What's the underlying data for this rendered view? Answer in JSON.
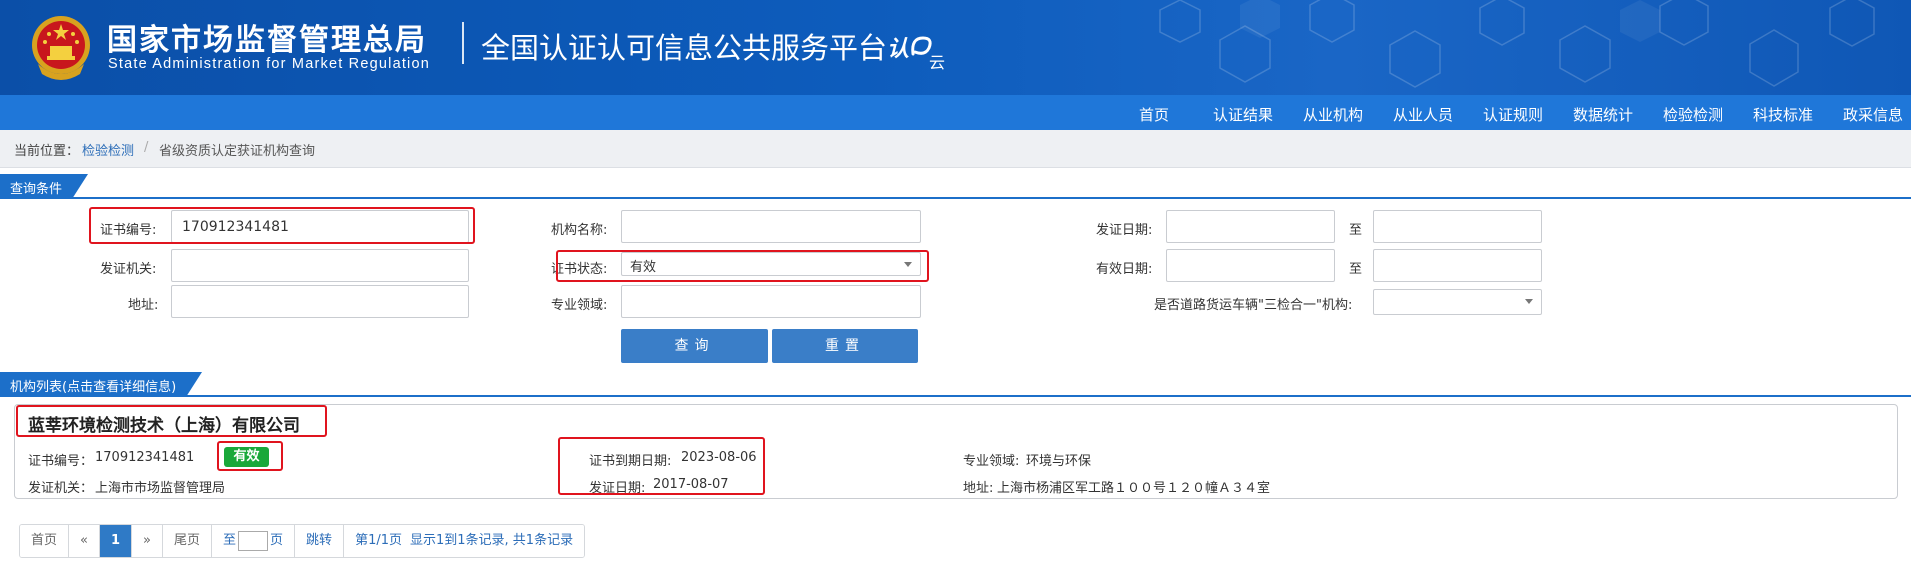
{
  "header": {
    "title_cn": "国家市场监督管理总局",
    "title_en": "State Administration  for  Market Regulation",
    "platform": "全国认证认可信息公共服务平台",
    "brand_logo_text": "认e云",
    "emblem_icon": "national-emblem-icon"
  },
  "nav": {
    "items": [
      "首页",
      "认证结果",
      "从业机构",
      "从业人员",
      "认证规则",
      "数据统计",
      "检验检测",
      "科技标准",
      "政采信息"
    ]
  },
  "breadcrumb": {
    "prefix": "当前位置：",
    "link": "检验检测",
    "separator": "/",
    "current": "省级资质认定获证机构查询"
  },
  "query": {
    "section_title": "查询条件",
    "cert_no_label": "证书编号:",
    "cert_no_value": "170912341481",
    "org_name_label": "机构名称:",
    "org_name_value": "",
    "issue_date_label": "发证日期:",
    "to_label": "至",
    "issuer_label": "发证机关:",
    "issuer_value": "",
    "cert_status_label": "证书状态:",
    "cert_status_value": "有效",
    "valid_date_label": "有效日期:",
    "address_label": "地址:",
    "address_value": "",
    "field_label": "专业领域:",
    "field_value": "",
    "three_in_one_label": "是否道路货运车辆\"三检合一\"机构:",
    "three_in_one_value": "",
    "search_button": "查询",
    "reset_button": "重置"
  },
  "results": {
    "section_title": "机构列表(点击查看详细信息)",
    "items": [
      {
        "org_name": "蓝莘环境检测技术（上海）有限公司",
        "cert_no_label": "证书编号：",
        "cert_no": "170912341481",
        "status": "有效",
        "expiry_label": "证书到期日期:",
        "expiry": "2023-08-06",
        "field_label": "专业领域:",
        "field": "环境与环保",
        "issuer_label": "发证机关：",
        "issuer": "上海市市场监督管理局",
        "issue_date_label": "发证日期:",
        "issue_date": "2017-08-07",
        "address_label": "地址:",
        "address": "上海市杨浦区军工路１００号１２０幢Ａ３４室"
      }
    ]
  },
  "pagination": {
    "first": "首页",
    "prev": "«",
    "current": "1",
    "next": "»",
    "last": "尾页",
    "goto_prefix": "至",
    "goto_suffix": "页",
    "jump": "跳转",
    "page_info": "第1/1页",
    "record_info": "显示1到1条记录, 共1条记录"
  },
  "colors": {
    "header_bg": "#0d5cbc",
    "nav_bg": "#1f77d9",
    "section_tab": "#1c6fc9",
    "button": "#3a7ec8",
    "status_valid": "#19a83a",
    "highlight_box": "#e0141e"
  }
}
